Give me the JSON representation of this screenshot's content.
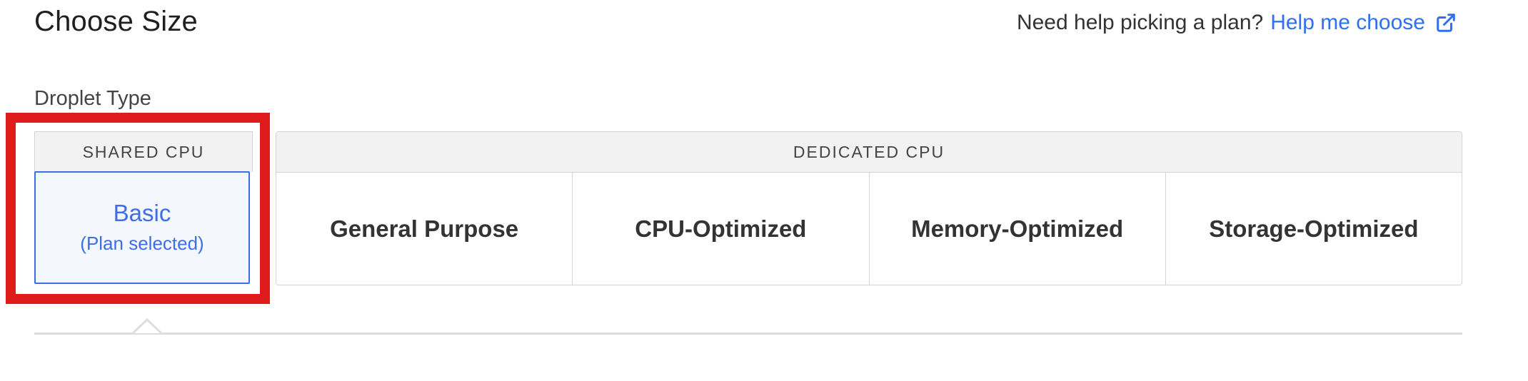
{
  "header": {
    "title": "Choose Size",
    "help_prompt": "Need help picking a plan?",
    "help_link": "Help me choose",
    "help_link_icon": "external-link-icon"
  },
  "droplet_type": {
    "label": "Droplet Type",
    "shared": {
      "header": "SHARED CPU",
      "option": {
        "label": "Basic",
        "sublabel": "(Plan selected)",
        "selected": true
      }
    },
    "dedicated": {
      "header": "DEDICATED CPU",
      "options": [
        {
          "label": "General Purpose"
        },
        {
          "label": "CPU-Optimized"
        },
        {
          "label": "Memory-Optimized"
        },
        {
          "label": "Storage-Optimized"
        }
      ]
    }
  },
  "colors": {
    "accent": "#2f6ff0",
    "selected_bg": "#f4f7fd",
    "highlight": "#e01b1b",
    "header_bg": "#f2f2f2"
  }
}
